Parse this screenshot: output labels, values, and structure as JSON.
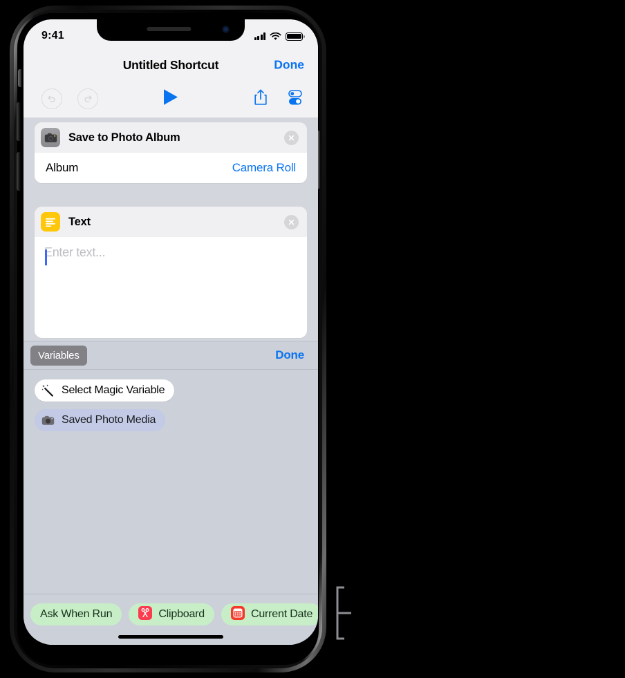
{
  "status_bar": {
    "time": "9:41",
    "cellular_icon": "signal-bars-icon",
    "wifi_icon": "wifi-icon",
    "battery_icon": "battery-full-icon"
  },
  "nav_bar": {
    "title": "Untitled Shortcut",
    "done_label": "Done"
  },
  "toolbar": {
    "undo_icon": "undo-arrow-icon",
    "redo_icon": "redo-arrow-icon",
    "play_icon": "play-triangle-icon",
    "share_icon": "share-up-arrow-icon",
    "settings_icon": "toggle-switches-icon",
    "accent_color": "#0a74f0"
  },
  "actions": [
    {
      "icon": "camera-icon",
      "icon_bg": "#8e8e93",
      "title": "Save to Photo Album",
      "close_icon": "close-circle-icon",
      "row_label": "Album",
      "row_value": "Camera Roll"
    },
    {
      "icon": "text-lines-icon",
      "icon_bg": "#ffc709",
      "title": "Text",
      "close_icon": "close-circle-icon",
      "placeholder": "Enter text..."
    }
  ],
  "variables_panel": {
    "chip_label": "Variables",
    "done_label": "Done",
    "magic_variable": {
      "icon": "magic-wand-icon",
      "label": "Select Magic Variable"
    },
    "saved_variable": {
      "icon": "camera-icon",
      "label": "Saved Photo Media",
      "bg": "#c2cae6"
    }
  },
  "bottom_bar": {
    "chip_bg": "#c8eec8",
    "chips": [
      {
        "label": "Ask When Run",
        "icon": null,
        "icon_bg": null
      },
      {
        "label": "Clipboard",
        "icon": "scissors-icon",
        "icon_bg": "#fb3b4e"
      },
      {
        "label": "Current Date",
        "icon": "calendar-icon",
        "icon_bg": "#f5392a"
      }
    ]
  },
  "annotation": {
    "bracket": "callout-bracket"
  }
}
